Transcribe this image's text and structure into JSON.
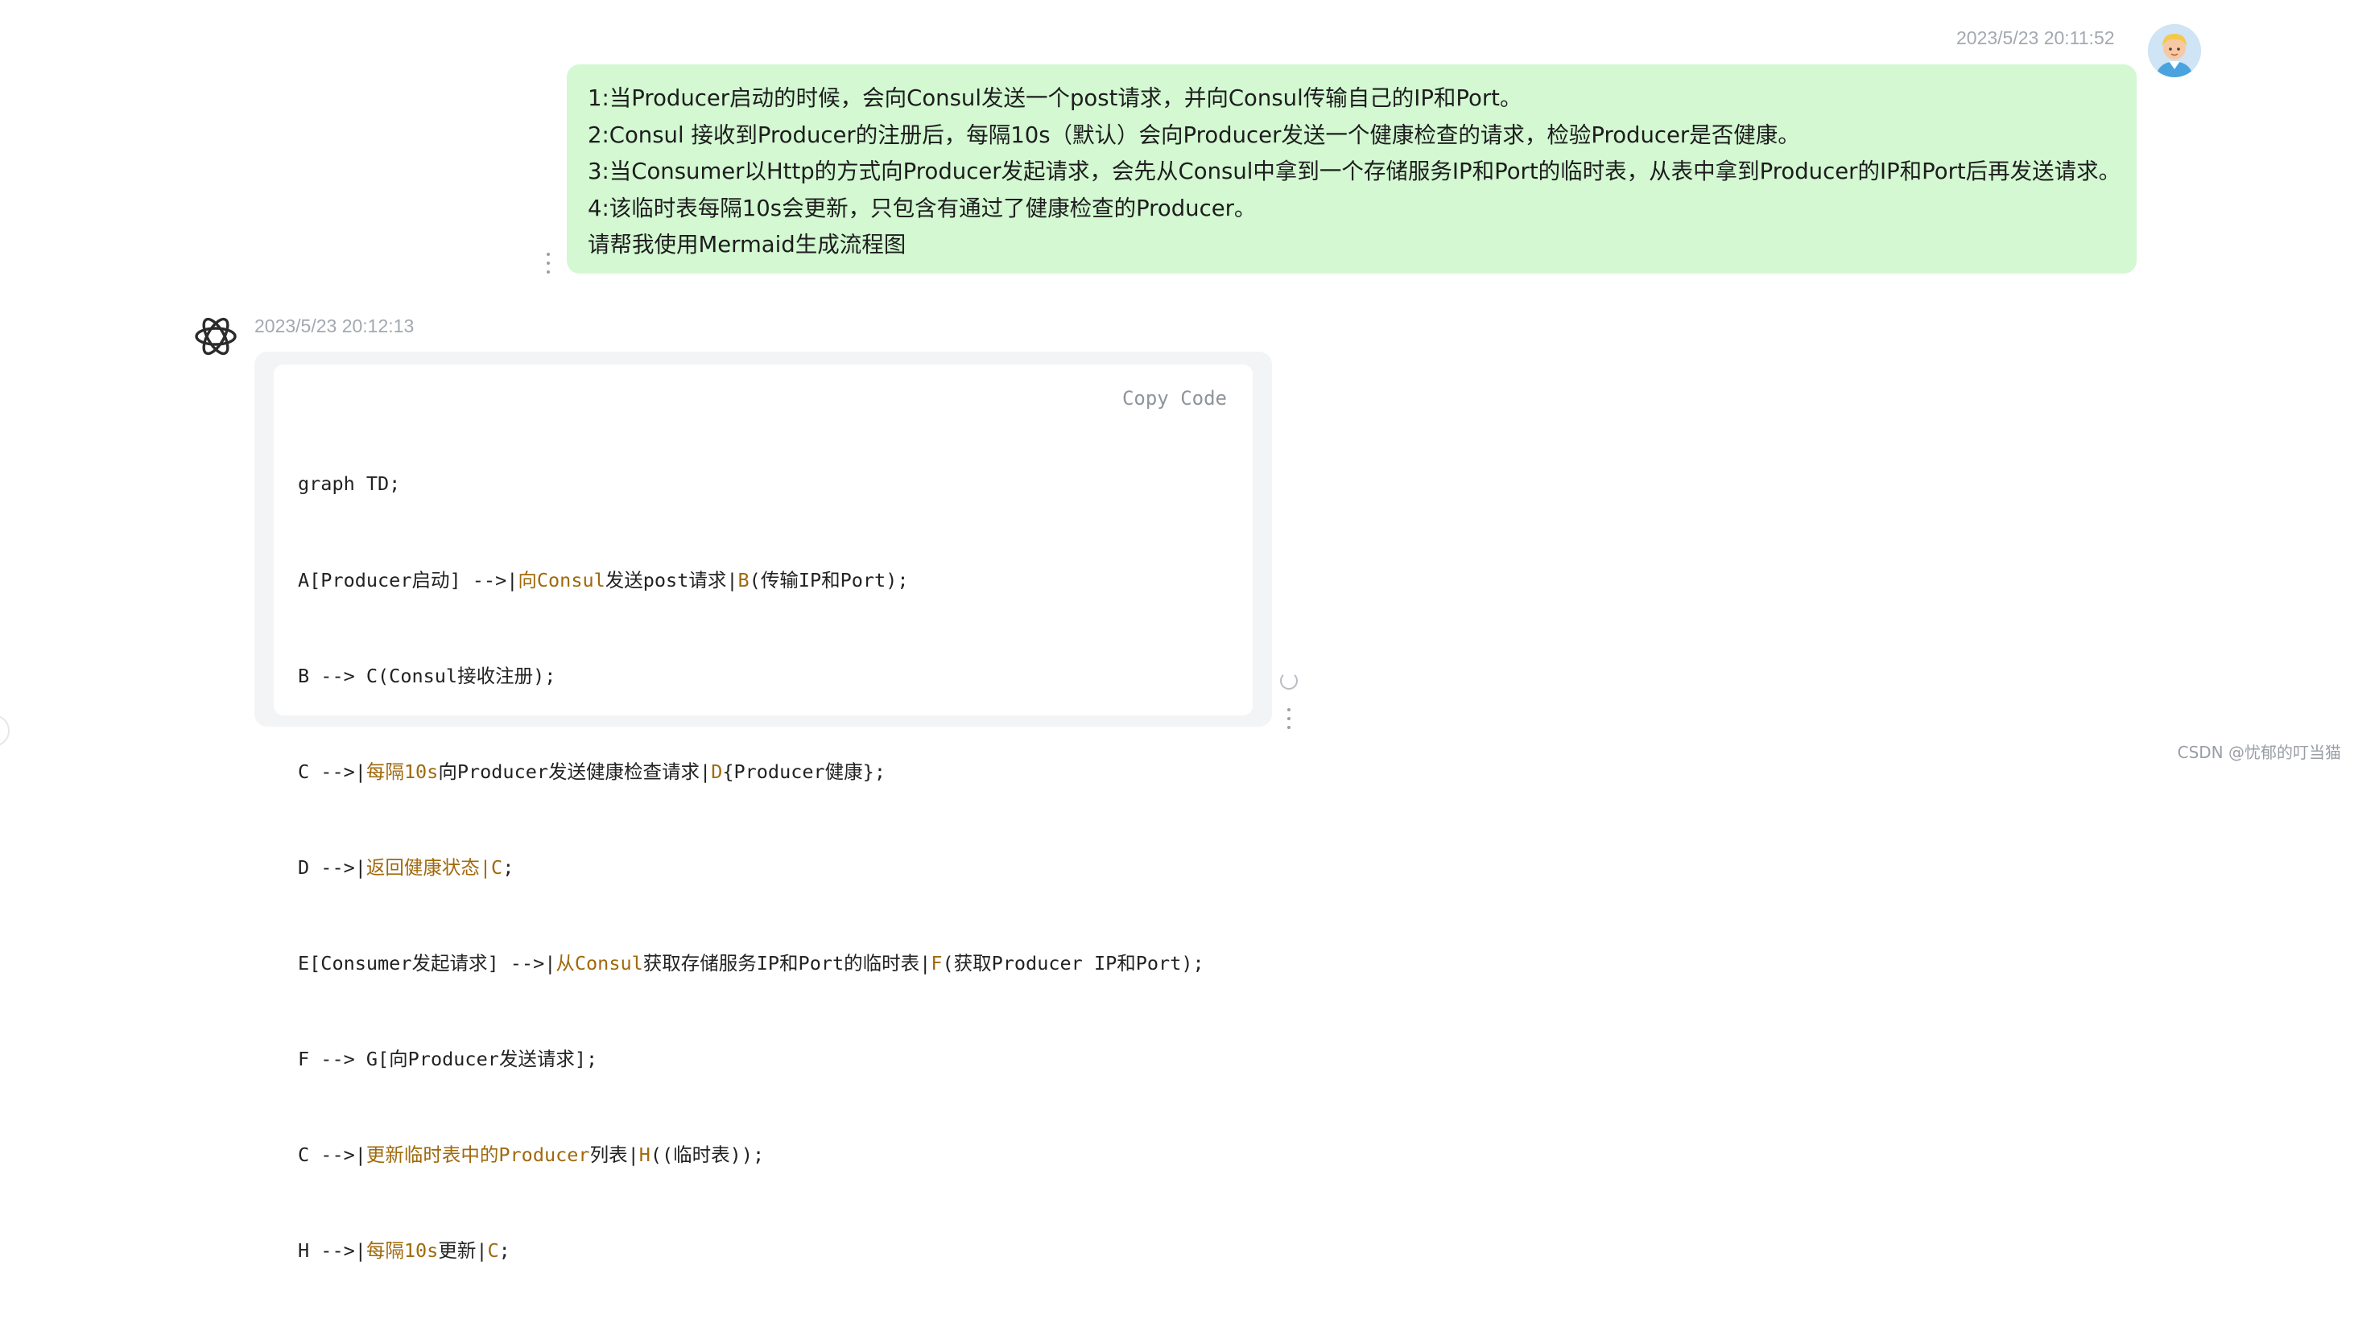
{
  "user_message": {
    "timestamp": "2023/5/23 20:11:52",
    "lines": [
      "1:当Producer启动的时候，会向Consul发送一个post请求，并向Consul传输自己的IP和Port。",
      "2:Consul 接收到Producer的注册后，每隔10s（默认）会向Producer发送一个健康检查的请求，检验Producer是否健康。",
      "3:当Consumer以Http的方式向Producer发起请求，会先从Consul中拿到一个存储服务IP和Port的临时表，从表中拿到Producer的IP和Port后再发送请求。",
      "4:该临时表每隔10s会更新，只包含有通过了健康检查的Producer。",
      "请帮我使用Mermaid生成流程图"
    ]
  },
  "bot_message": {
    "timestamp": "2023/5/23 20:12:13",
    "copy_label": "Copy Code",
    "code": [
      {
        "a": "graph TD;"
      },
      {
        "a": "A[Producer启动] -->|",
        "hl": "向Consul",
        "b": "发送post请求|",
        "hl2": "B",
        "c": "(传输IP和Port);"
      },
      {
        "a": "B --> C(Consul接收注册);"
      },
      {
        "a": "C -->|",
        "hl": "每隔10s",
        "b": "向Producer发送健康检查请求|",
        "hl2": "D",
        "c": "{Producer健康};"
      },
      {
        "a": "D -->|",
        "hl": "返回健康状态|C",
        "b": ";"
      },
      {
        "a": "E[Consumer发起请求] -->|",
        "hl": "从Consul",
        "b": "获取存储服务IP和Port的临时表|",
        "hl2": "F",
        "c": "(获取Producer IP和Port);"
      },
      {
        "a": "F --> G[向Producer发送请求];"
      },
      {
        "a": "C -->|",
        "hl": "更新临时表中的Producer",
        "b": "列表|",
        "hl2": "H",
        "c": "((临时表));"
      },
      {
        "a": "H -->|",
        "hl": "每隔10s",
        "b": "更新|",
        "hl2": "C",
        "c": ";"
      }
    ]
  },
  "icons": {
    "user_avatar": "user-avatar-icon",
    "bot_avatar": "openai-logo-icon",
    "menu": "kebab-menu-icon",
    "regenerate": "refresh-icon"
  },
  "watermark": "CSDN @忧郁的叮当猫",
  "colors": {
    "user_bubble": "#d3f8d2",
    "code_highlight": "#a0690c",
    "timestamp": "#a3a8b0"
  }
}
